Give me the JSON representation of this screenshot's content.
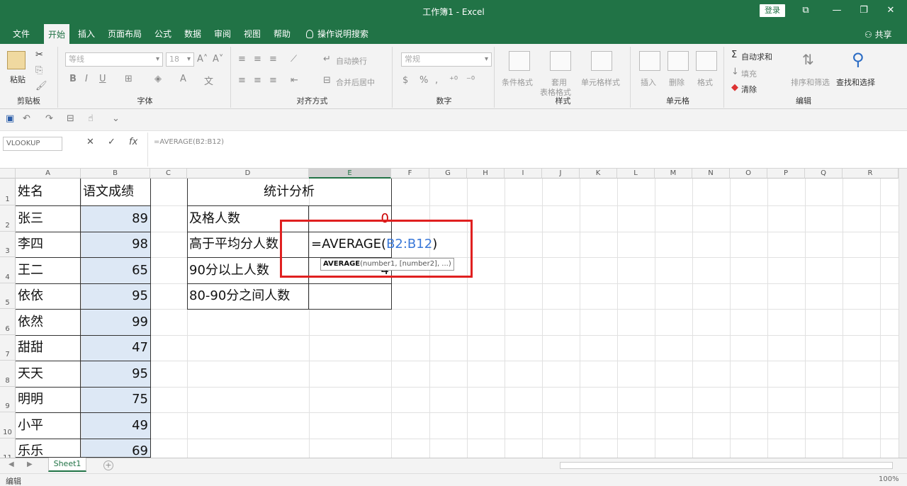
{
  "window": {
    "title": "工作簿1  -  Excel",
    "login_label": "登录",
    "btn_ribbon_opts": "⧉",
    "btn_minimize": "—",
    "btn_restore": "❐",
    "btn_close": "✕"
  },
  "tabs": [
    {
      "label": "文件"
    },
    {
      "label": "开始"
    },
    {
      "label": "插入"
    },
    {
      "label": "页面布局"
    },
    {
      "label": "公式"
    },
    {
      "label": "数据"
    },
    {
      "label": "审阅"
    },
    {
      "label": "视图"
    },
    {
      "label": "帮助"
    },
    {
      "label": "操作说明搜索"
    }
  ],
  "share_label": "共享",
  "ribbon": {
    "clipboard": {
      "label": "剪贴板",
      "paste": "粘贴"
    },
    "font": {
      "label": "字体",
      "name": "等线",
      "size": "18",
      "bold": "B",
      "italic": "I",
      "underline": "U"
    },
    "alignment": {
      "label": "对齐方式",
      "wrap": "自动换行",
      "merge": "合并后居中"
    },
    "number": {
      "label": "数字",
      "format": "常规"
    },
    "styles": {
      "label": "样式",
      "conditional": "条件格式",
      "table": "套用",
      "table2": "表格格式",
      "cell": "单元格样式"
    },
    "cells": {
      "label": "单元格",
      "insert": "插入",
      "delete": "删除",
      "format": "格式"
    },
    "editing": {
      "label": "编辑",
      "autosum": "自动求和",
      "fill": "填充",
      "clear": "清除",
      "sort": "排序和筛选",
      "find": "查找和选择"
    }
  },
  "formula_bar": {
    "name_box": "VLOOKUP",
    "cancel": "✕",
    "enter": "✓",
    "fx": "fx",
    "content": "=AVERAGE(B2:B12)"
  },
  "columns": [
    "A",
    "B",
    "C",
    "D",
    "E",
    "F",
    "G",
    "H",
    "I",
    "J",
    "K",
    "L",
    "M",
    "N",
    "O",
    "P",
    "Q",
    "R"
  ],
  "rows": [
    "1",
    "2",
    "3",
    "4",
    "5",
    "6",
    "7",
    "8",
    "9",
    "10",
    "11"
  ],
  "table": {
    "header_name": "姓名",
    "header_score": "语文成绩",
    "records": [
      {
        "name": "张三",
        "score": "89"
      },
      {
        "name": "李四",
        "score": "98"
      },
      {
        "name": "王二",
        "score": "65"
      },
      {
        "name": "依依",
        "score": "95"
      },
      {
        "name": "依然",
        "score": "99"
      },
      {
        "name": "甜甜",
        "score": "47"
      },
      {
        "name": "天天",
        "score": "95"
      },
      {
        "name": "明明",
        "score": "75"
      },
      {
        "name": "小平",
        "score": "49"
      },
      {
        "name": "乐乐",
        "score": "69"
      }
    ]
  },
  "stats": {
    "title": "统计分析",
    "rows": [
      {
        "label": "及格人数",
        "value": "0"
      },
      {
        "label": "高于平均分人数",
        "value": ""
      },
      {
        "label": "90分以上人数",
        "value": "4"
      },
      {
        "label": "80-90分之间人数",
        "value": ""
      }
    ],
    "editing_prefix": "=AVERAGE(",
    "editing_ref": "B2:B12",
    "editing_suffix": ")",
    "tooltip_fn": "AVERAGE",
    "tooltip_args": "(number1, [number2], ...)"
  },
  "colors": {
    "excel_green": "#217346",
    "highlight_red": "#e02020",
    "ref_blue": "#3a78d8"
  },
  "sheet_tab": "Sheet1",
  "add_sheet": "+",
  "status": {
    "mode": "编辑",
    "zoom": "100%"
  }
}
